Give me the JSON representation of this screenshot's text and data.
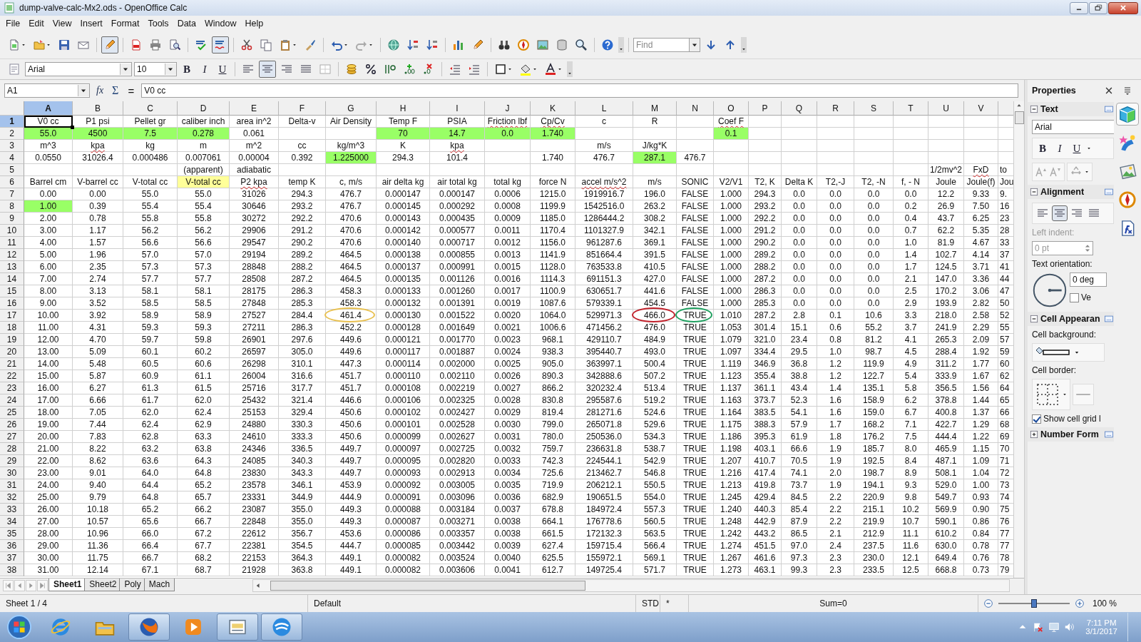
{
  "window": {
    "title": "dump-valve-calc-Mx2.ods - OpenOffice Calc"
  },
  "menu": [
    "File",
    "Edit",
    "View",
    "Insert",
    "Format",
    "Tools",
    "Data",
    "Window",
    "Help"
  ],
  "toolbar": {
    "edit_mode_on": true,
    "auto_spellcheck_on": true,
    "find": {
      "placeholder": "Find"
    }
  },
  "formatting": {
    "font": "Arial",
    "size": "10",
    "styles": [
      "B",
      "I",
      "U"
    ],
    "align": [
      {
        "kind": "left",
        "selected": false
      },
      {
        "kind": "center",
        "selected": true
      },
      {
        "kind": "right",
        "selected": false
      },
      {
        "kind": "justify",
        "selected": false
      }
    ]
  },
  "formula_bar": {
    "name_box": "A1",
    "function_glyph": "fx",
    "sum_glyph": "Σ",
    "equals": "=",
    "content": "V0 cc"
  },
  "sheet": {
    "columns": [
      {
        "label": "A",
        "selected": true
      },
      {
        "label": "B",
        "selected": false
      },
      {
        "label": "C",
        "selected": false
      },
      {
        "label": "D",
        "selected": false
      },
      {
        "label": "E",
        "selected": false
      },
      {
        "label": "F",
        "selected": false
      },
      {
        "label": "G",
        "selected": false
      },
      {
        "label": "H",
        "selected": false
      },
      {
        "label": "I",
        "selected": false
      },
      {
        "label": "J",
        "selected": false
      },
      {
        "label": "K",
        "selected": false
      },
      {
        "label": "L",
        "selected": false
      },
      {
        "label": "M",
        "selected": false
      },
      {
        "label": "N",
        "selected": false
      },
      {
        "label": "O",
        "selected": false
      },
      {
        "label": "P",
        "selected": false
      },
      {
        "label": "Q",
        "selected": false
      },
      {
        "label": "R",
        "selected": false
      },
      {
        "label": "S",
        "selected": false
      },
      {
        "label": "T",
        "selected": false
      },
      {
        "label": "U",
        "selected": false
      },
      {
        "label": "V",
        "selected": false
      }
    ],
    "rows": [
      {
        "number": "1",
        "selected": true,
        "cells": [
          "V0 cc",
          "P1 psi",
          "Pellet gr",
          "caliber inch",
          "area in^2",
          "Delta-v",
          "Air Density",
          "Temp F",
          "PSIA",
          {
            "text": "Friction lbf",
            "misspelled": true
          },
          {
            "text": "Cp/Cv",
            "misspelled": true
          },
          "c",
          "R",
          null,
          {
            "text": "Coef F",
            "misspelled": true
          }
        ]
      },
      {
        "number": "2",
        "selected": false,
        "cells": [
          {
            "text": "55.0",
            "color": "#99ff66"
          },
          {
            "text": "4500",
            "color": "#99ff66"
          },
          {
            "text": "7.5",
            "color": "#99ff66"
          },
          {
            "text": "0.278",
            "color": "#99ff66"
          },
          "0.061",
          null,
          null,
          {
            "text": "70",
            "color": "#99ff66"
          },
          {
            "text": "14.7",
            "color": "#99ff66"
          },
          {
            "text": "0.0",
            "color": "#99ff66"
          },
          {
            "text": "1.740",
            "color": "#99ff66"
          },
          null,
          null,
          null,
          {
            "text": "0.1",
            "color": "#99ff66"
          }
        ]
      },
      {
        "number": "3",
        "selected": false,
        "cells": [
          "m^3",
          {
            "text": "kpa",
            "misspelled": true
          },
          "kg",
          "m",
          "m^2",
          "cc",
          "kg/m^3",
          "K",
          {
            "text": "kpa",
            "misspelled": true
          },
          null,
          null,
          "m/s",
          "J/kg*K"
        ]
      },
      {
        "number": "4",
        "selected": false,
        "cells": [
          "0.0550",
          "31026.4",
          "0.000486",
          "0.007061",
          "0.00004",
          "0.392",
          {
            "text": "1.225000",
            "color": "#99ff66"
          },
          "294.3",
          "101.4",
          null,
          "1.740",
          "476.7",
          {
            "text": "287.1",
            "color": "#99ff66"
          },
          "476.7"
        ]
      },
      {
        "number": "5",
        "selected": false,
        "cells": [
          null,
          null,
          null,
          "(apparent)",
          "adiabatic",
          null,
          null,
          null,
          null,
          null,
          null,
          null,
          null,
          null,
          null,
          null,
          null,
          null,
          null,
          null,
          "1/2mv^2",
          {
            "text": "FxD",
            "misspelled": true
          },
          "to"
        ]
      },
      {
        "number": "6",
        "selected": false,
        "cells": [
          "Barrel cm",
          "V-barrel cc",
          "V-total cc",
          {
            "text": "V-total cc",
            "color": "#ffff99"
          },
          {
            "text": "P2 kpa",
            "misspelled": true
          },
          "temp K",
          "c, m/s",
          "air delta kg",
          "air total kg",
          "total kg",
          "force N",
          {
            "text": "accel m/s^2",
            "misspelled": true
          },
          "m/s",
          "SONIC",
          "V2/V1",
          "T2, K",
          "Delta K",
          "T2,-J",
          "T2, -N",
          "f, - N",
          "Joule",
          "Joule(f)",
          "Jou"
        ]
      },
      {
        "number": "7",
        "selected": false,
        "cells": [
          "0.00",
          "0.00",
          "55.0",
          "55.0",
          "31026",
          "294.3",
          "476.7",
          "0.000147",
          "0.000147",
          "0.0006",
          "1215.0",
          "1919916.7",
          "196.0",
          "FALSE",
          "1.000",
          "294.3",
          "0.0",
          "0.0",
          "0.0",
          "0.0",
          "12.2",
          "9.33",
          "9."
        ]
      },
      {
        "number": "8",
        "selected": false,
        "cells": [
          {
            "text": "1.00",
            "color": "#99ff66"
          },
          "0.39",
          "55.4",
          "55.4",
          "30646",
          "293.2",
          "476.7",
          "0.000145",
          "0.000292",
          "0.0008",
          "1199.9",
          "1542516.0",
          "263.2",
          "FALSE",
          "1.000",
          "293.2",
          "0.0",
          "0.0",
          "0.0",
          "0.2",
          "26.9",
          "7.50",
          "16"
        ]
      },
      {
        "number": "9",
        "selected": false,
        "cells": [
          "2.00",
          "0.78",
          "55.8",
          "55.8",
          "30272",
          "292.2",
          "470.6",
          "0.000143",
          "0.000435",
          "0.0009",
          "1185.0",
          "1286444.2",
          "308.2",
          "FALSE",
          "1.000",
          "292.2",
          "0.0",
          "0.0",
          "0.0",
          "0.4",
          "43.7",
          "6.25",
          "23"
        ]
      },
      {
        "number": "10",
        "selected": false,
        "cells": [
          "3.00",
          "1.17",
          "56.2",
          "56.2",
          "29906",
          "291.2",
          "470.6",
          "0.000142",
          "0.000577",
          "0.0011",
          "1170.4",
          "1101327.9",
          "342.1",
          "FALSE",
          "1.000",
          "291.2",
          "0.0",
          "0.0",
          "0.0",
          "0.7",
          "62.2",
          "5.35",
          "28"
        ]
      },
      {
        "number": "11",
        "selected": false,
        "cells": [
          "4.00",
          "1.57",
          "56.6",
          "56.6",
          "29547",
          "290.2",
          "470.6",
          "0.000140",
          "0.000717",
          "0.0012",
          "1156.0",
          "961287.6",
          "369.1",
          "FALSE",
          "1.000",
          "290.2",
          "0.0",
          "0.0",
          "0.0",
          "1.0",
          "81.9",
          "4.67",
          "33"
        ]
      },
      {
        "number": "12",
        "selected": false,
        "cells": [
          "5.00",
          "1.96",
          "57.0",
          "57.0",
          "29194",
          "289.2",
          "464.5",
          "0.000138",
          "0.000855",
          "0.0013",
          "1141.9",
          "851664.4",
          "391.5",
          "FALSE",
          "1.000",
          "289.2",
          "0.0",
          "0.0",
          "0.0",
          "1.4",
          "102.7",
          "4.14",
          "37"
        ]
      },
      {
        "number": "13",
        "selected": false,
        "cells": [
          "6.00",
          "2.35",
          "57.3",
          "57.3",
          "28848",
          "288.2",
          "464.5",
          "0.000137",
          "0.000991",
          "0.0015",
          "1128.0",
          "763533.8",
          "410.5",
          "FALSE",
          "1.000",
          "288.2",
          "0.0",
          "0.0",
          "0.0",
          "1.7",
          "124.5",
          "3.71",
          "41"
        ]
      },
      {
        "number": "14",
        "selected": false,
        "cells": [
          "7.00",
          "2.74",
          "57.7",
          "57.7",
          "28508",
          "287.2",
          "464.5",
          "0.000135",
          "0.001126",
          "0.0016",
          "1114.3",
          "691151.3",
          "427.0",
          "FALSE",
          "1.000",
          "287.2",
          "0.0",
          "0.0",
          "0.0",
          "2.1",
          "147.0",
          "3.36",
          "44"
        ]
      },
      {
        "number": "15",
        "selected": false,
        "cells": [
          "8.00",
          "3.13",
          "58.1",
          "58.1",
          "28175",
          "286.3",
          "458.3",
          "0.000133",
          "0.001260",
          "0.0017",
          "1100.9",
          "630651.7",
          "441.6",
          "FALSE",
          "1.000",
          "286.3",
          "0.0",
          "0.0",
          "0.0",
          "2.5",
          "170.2",
          "3.06",
          "47"
        ]
      },
      {
        "number": "16",
        "selected": false,
        "cells": [
          "9.00",
          "3.52",
          "58.5",
          "58.5",
          "27848",
          "285.3",
          "458.3",
          "0.000132",
          "0.001391",
          "0.0019",
          "1087.6",
          "579339.1",
          "454.5",
          "FALSE",
          "1.000",
          "285.3",
          "0.0",
          "0.0",
          "0.0",
          "2.9",
          "193.9",
          "2.82",
          "50"
        ]
      },
      {
        "number": "17",
        "selected": false,
        "cells": [
          "10.00",
          "3.92",
          "58.9",
          "58.9",
          "27527",
          "284.4",
          {
            "text": "461.4",
            "kind": "ellipse",
            "color": "#e8c050"
          },
          "0.000130",
          "0.001522",
          "0.0020",
          "1064.0",
          "529971.3",
          {
            "text": "466.0",
            "kind": "ellipse",
            "color": "#c0202a"
          },
          {
            "text": "TRUE",
            "kind": "ellipse",
            "color": "#20a060"
          },
          "1.010",
          "287.2",
          "2.8",
          "0.1",
          "10.6",
          "3.3",
          "218.0",
          "2.58",
          "52"
        ]
      },
      {
        "number": "18",
        "selected": false,
        "cells": [
          "11.00",
          "4.31",
          "59.3",
          "59.3",
          "27211",
          "286.3",
          "452.2",
          "0.000128",
          "0.001649",
          "0.0021",
          "1006.6",
          "471456.2",
          "476.0",
          "TRUE",
          "1.053",
          "301.4",
          "15.1",
          "0.6",
          "55.2",
          "3.7",
          "241.9",
          "2.29",
          "55"
        ]
      },
      {
        "number": "19",
        "selected": false,
        "cells": [
          "12.00",
          "4.70",
          "59.7",
          "59.8",
          "26901",
          "297.6",
          "449.6",
          "0.000121",
          "0.001770",
          "0.0023",
          "968.1",
          "429110.7",
          "484.9",
          "TRUE",
          "1.079",
          "321.0",
          "23.4",
          "0.8",
          "81.2",
          "4.1",
          "265.3",
          "2.09",
          "57"
        ]
      },
      {
        "number": "20",
        "selected": false,
        "cells": [
          "13.00",
          "5.09",
          "60.1",
          "60.2",
          "26597",
          "305.0",
          "449.6",
          "0.000117",
          "0.001887",
          "0.0024",
          "938.3",
          "395440.7",
          "493.0",
          "TRUE",
          "1.097",
          "334.4",
          "29.5",
          "1.0",
          "98.7",
          "4.5",
          "288.4",
          "1.92",
          "59"
        ]
      },
      {
        "number": "21",
        "selected": false,
        "cells": [
          "14.00",
          "5.48",
          "60.5",
          "60.6",
          "26298",
          "310.1",
          "447.3",
          "0.000114",
          "0.002000",
          "0.0025",
          "905.0",
          "363997.1",
          "500.4",
          "TRUE",
          "1.119",
          "346.9",
          "36.8",
          "1.2",
          "119.9",
          "4.9",
          "311.2",
          "1.77",
          "60"
        ]
      },
      {
        "number": "22",
        "selected": false,
        "cells": [
          "15.00",
          "5.87",
          "60.9",
          "61.1",
          "26004",
          "316.6",
          "451.7",
          "0.000110",
          "0.002110",
          "0.0026",
          "890.3",
          "342888.6",
          "507.2",
          "TRUE",
          "1.123",
          "355.4",
          "38.8",
          "1.2",
          "122.7",
          "5.4",
          "333.9",
          "1.67",
          "62"
        ]
      },
      {
        "number": "23",
        "selected": false,
        "cells": [
          "16.00",
          "6.27",
          "61.3",
          "61.5",
          "25716",
          "317.7",
          "451.7",
          "0.000108",
          "0.002219",
          "0.0027",
          "866.2",
          "320232.4",
          "513.4",
          "TRUE",
          "1.137",
          "361.1",
          "43.4",
          "1.4",
          "135.1",
          "5.8",
          "356.5",
          "1.56",
          "64"
        ]
      },
      {
        "number": "24",
        "selected": false,
        "cells": [
          "17.00",
          "6.66",
          "61.7",
          "62.0",
          "25432",
          "321.4",
          "446.6",
          "0.000106",
          "0.002325",
          "0.0028",
          "830.8",
          "295587.6",
          "519.2",
          "TRUE",
          "1.163",
          "373.7",
          "52.3",
          "1.6",
          "158.9",
          "6.2",
          "378.8",
          "1.44",
          "65"
        ]
      },
      {
        "number": "25",
        "selected": false,
        "cells": [
          "18.00",
          "7.05",
          "62.0",
          "62.4",
          "25153",
          "329.4",
          "450.6",
          "0.000102",
          "0.002427",
          "0.0029",
          "819.4",
          "281271.6",
          "524.6",
          "TRUE",
          "1.164",
          "383.5",
          "54.1",
          "1.6",
          "159.0",
          "6.7",
          "400.8",
          "1.37",
          "66"
        ]
      },
      {
        "number": "26",
        "selected": false,
        "cells": [
          "19.00",
          "7.44",
          "62.4",
          "62.9",
          "24880",
          "330.3",
          "450.6",
          "0.000101",
          "0.002528",
          "0.0030",
          "799.0",
          "265071.8",
          "529.6",
          "TRUE",
          "1.175",
          "388.3",
          "57.9",
          "1.7",
          "168.2",
          "7.1",
          "422.7",
          "1.29",
          "68"
        ]
      },
      {
        "number": "27",
        "selected": false,
        "cells": [
          "20.00",
          "7.83",
          "62.8",
          "63.3",
          "24610",
          "333.3",
          "450.6",
          "0.000099",
          "0.002627",
          "0.0031",
          "780.0",
          "250536.0",
          "534.3",
          "TRUE",
          "1.186",
          "395.3",
          "61.9",
          "1.8",
          "176.2",
          "7.5",
          "444.4",
          "1.22",
          "69"
        ]
      },
      {
        "number": "28",
        "selected": false,
        "cells": [
          "21.00",
          "8.22",
          "63.2",
          "63.8",
          "24346",
          "336.5",
          "449.7",
          "0.000097",
          "0.002725",
          "0.0032",
          "759.7",
          "236631.8",
          "538.7",
          "TRUE",
          "1.198",
          "403.1",
          "66.6",
          "1.9",
          "185.7",
          "8.0",
          "465.9",
          "1.15",
          "70"
        ]
      },
      {
        "number": "29",
        "selected": false,
        "cells": [
          "22.00",
          "8.62",
          "63.6",
          "64.3",
          "24085",
          "340.3",
          "449.7",
          "0.000095",
          "0.002820",
          "0.0033",
          "742.3",
          "224544.1",
          "542.9",
          "TRUE",
          "1.207",
          "410.7",
          "70.5",
          "1.9",
          "192.5",
          "8.4",
          "487.1",
          "1.09",
          "71"
        ]
      },
      {
        "number": "30",
        "selected": false,
        "cells": [
          "23.00",
          "9.01",
          "64.0",
          "64.8",
          "23830",
          "343.3",
          "449.7",
          "0.000093",
          "0.002913",
          "0.0034",
          "725.6",
          "213462.7",
          "546.8",
          "TRUE",
          "1.216",
          "417.4",
          "74.1",
          "2.0",
          "198.7",
          "8.9",
          "508.1",
          "1.04",
          "72"
        ]
      },
      {
        "number": "31",
        "selected": false,
        "cells": [
          "24.00",
          "9.40",
          "64.4",
          "65.2",
          "23578",
          "346.1",
          "453.9",
          "0.000092",
          "0.003005",
          "0.0035",
          "719.9",
          "206212.1",
          "550.5",
          "TRUE",
          "1.213",
          "419.8",
          "73.7",
          "1.9",
          "194.1",
          "9.3",
          "529.0",
          "1.00",
          "73"
        ]
      },
      {
        "number": "32",
        "selected": false,
        "cells": [
          "25.00",
          "9.79",
          "64.8",
          "65.7",
          "23331",
          "344.9",
          "444.9",
          "0.000091",
          "0.003096",
          "0.0036",
          "682.9",
          "190651.5",
          "554.0",
          "TRUE",
          "1.245",
          "429.4",
          "84.5",
          "2.2",
          "220.9",
          "9.8",
          "549.7",
          "0.93",
          "74"
        ]
      },
      {
        "number": "33",
        "selected": false,
        "cells": [
          "26.00",
          "10.18",
          "65.2",
          "66.2",
          "23087",
          "355.0",
          "449.3",
          "0.000088",
          "0.003184",
          "0.0037",
          "678.8",
          "184972.4",
          "557.3",
          "TRUE",
          "1.240",
          "440.3",
          "85.4",
          "2.2",
          "215.1",
          "10.2",
          "569.9",
          "0.90",
          "75"
        ]
      },
      {
        "number": "34",
        "selected": false,
        "cells": [
          "27.00",
          "10.57",
          "65.6",
          "66.7",
          "22848",
          "355.0",
          "449.3",
          "0.000087",
          "0.003271",
          "0.0038",
          "664.1",
          "176778.6",
          "560.5",
          "TRUE",
          "1.248",
          "442.9",
          "87.9",
          "2.2",
          "219.9",
          "10.7",
          "590.1",
          "0.86",
          "76"
        ]
      },
      {
        "number": "35",
        "selected": false,
        "cells": [
          "28.00",
          "10.96",
          "66.0",
          "67.2",
          "22612",
          "356.7",
          "453.6",
          "0.000086",
          "0.003357",
          "0.0038",
          "661.5",
          "172132.3",
          "563.5",
          "TRUE",
          "1.242",
          "443.2",
          "86.5",
          "2.1",
          "212.9",
          "11.1",
          "610.2",
          "0.84",
          "77"
        ]
      },
      {
        "number": "36",
        "selected": false,
        "cells": [
          "29.00",
          "11.36",
          "66.4",
          "67.7",
          "22381",
          "354.5",
          "444.7",
          "0.000085",
          "0.003442",
          "0.0039",
          "627.4",
          "159715.4",
          "566.4",
          "TRUE",
          "1.274",
          "451.5",
          "97.0",
          "2.4",
          "237.5",
          "11.6",
          "630.0",
          "0.78",
          "77"
        ]
      },
      {
        "number": "37",
        "selected": false,
        "cells": [
          "30.00",
          "11.75",
          "66.7",
          "68.2",
          "22153",
          "364.3",
          "449.1",
          "0.000082",
          "0.003524",
          "0.0040",
          "625.5",
          "155972.1",
          "569.1",
          "TRUE",
          "1.267",
          "461.6",
          "97.3",
          "2.3",
          "230.0",
          "12.1",
          "649.4",
          "0.76",
          "78"
        ]
      },
      {
        "number": "38",
        "selected": false,
        "cells": [
          "31.00",
          "12.14",
          "67.1",
          "68.7",
          "21928",
          "363.8",
          "449.1",
          "0.000082",
          "0.003606",
          "0.0041",
          "612.7",
          "149725.4",
          "571.7",
          "TRUE",
          "1.273",
          "463.1",
          "99.3",
          "2.3",
          "233.5",
          "12.5",
          "668.8",
          "0.73",
          "79"
        ]
      }
    ]
  },
  "sheet_tabs": [
    {
      "label": "Sheet1",
      "selected": true
    },
    {
      "label": "Sheet2",
      "selected": false
    },
    {
      "label": "Poly",
      "selected": false
    },
    {
      "label": "Mach",
      "selected": false
    }
  ],
  "properties": {
    "title": "Properties",
    "text_section": {
      "title": "Text",
      "expanded": true,
      "font": "Arial",
      "styles": [
        "B",
        "I",
        "U"
      ]
    },
    "alignment_section": {
      "title": "Alignment",
      "expanded": true,
      "buttons": [
        {
          "kind": "left",
          "selected": false
        },
        {
          "kind": "center",
          "selected": true
        },
        {
          "kind": "right",
          "selected": false
        },
        {
          "kind": "justify",
          "selected": false
        }
      ],
      "indent_label": "Left indent:",
      "indent_value": "0 pt",
      "indent_disabled": true,
      "orientation_label": "Text orientation:",
      "orientation_value": "0 deg",
      "vertical_label": "Ve",
      "vertical_checked": false
    },
    "cell_section": {
      "title": "Cell Appearan",
      "expanded": true,
      "background_label": "Cell background:",
      "border_label": "Cell border:",
      "grid_label": "Show cell grid l",
      "grid_checked": true
    },
    "number_section": {
      "title": "Number Form",
      "expanded": false
    },
    "deck": [
      {
        "kind": "properties",
        "selected": true
      },
      {
        "kind": "styles",
        "selected": false
      },
      {
        "kind": "gallery",
        "selected": false
      },
      {
        "kind": "navigator",
        "selected": false
      },
      {
        "kind": "functions",
        "selected": false
      }
    ]
  },
  "status_bar": {
    "sheet": "Sheet 1 / 4",
    "style": "Default",
    "mode": "STD",
    "modified": "*",
    "sum": "Sum=0",
    "zoom": {
      "level": 0.5
    },
    "zoom_reading": "100 %"
  },
  "taskbar": {
    "apps": [
      {
        "kind": "ie",
        "active": false
      },
      {
        "kind": "explorer",
        "active": false
      },
      {
        "kind": "firefox",
        "active": true
      },
      {
        "kind": "media",
        "active": false
      },
      {
        "kind": "mail",
        "active": true
      },
      {
        "kind": "office",
        "active": true
      }
    ],
    "time": "7:11 PM",
    "date": "3/1/2017"
  }
}
